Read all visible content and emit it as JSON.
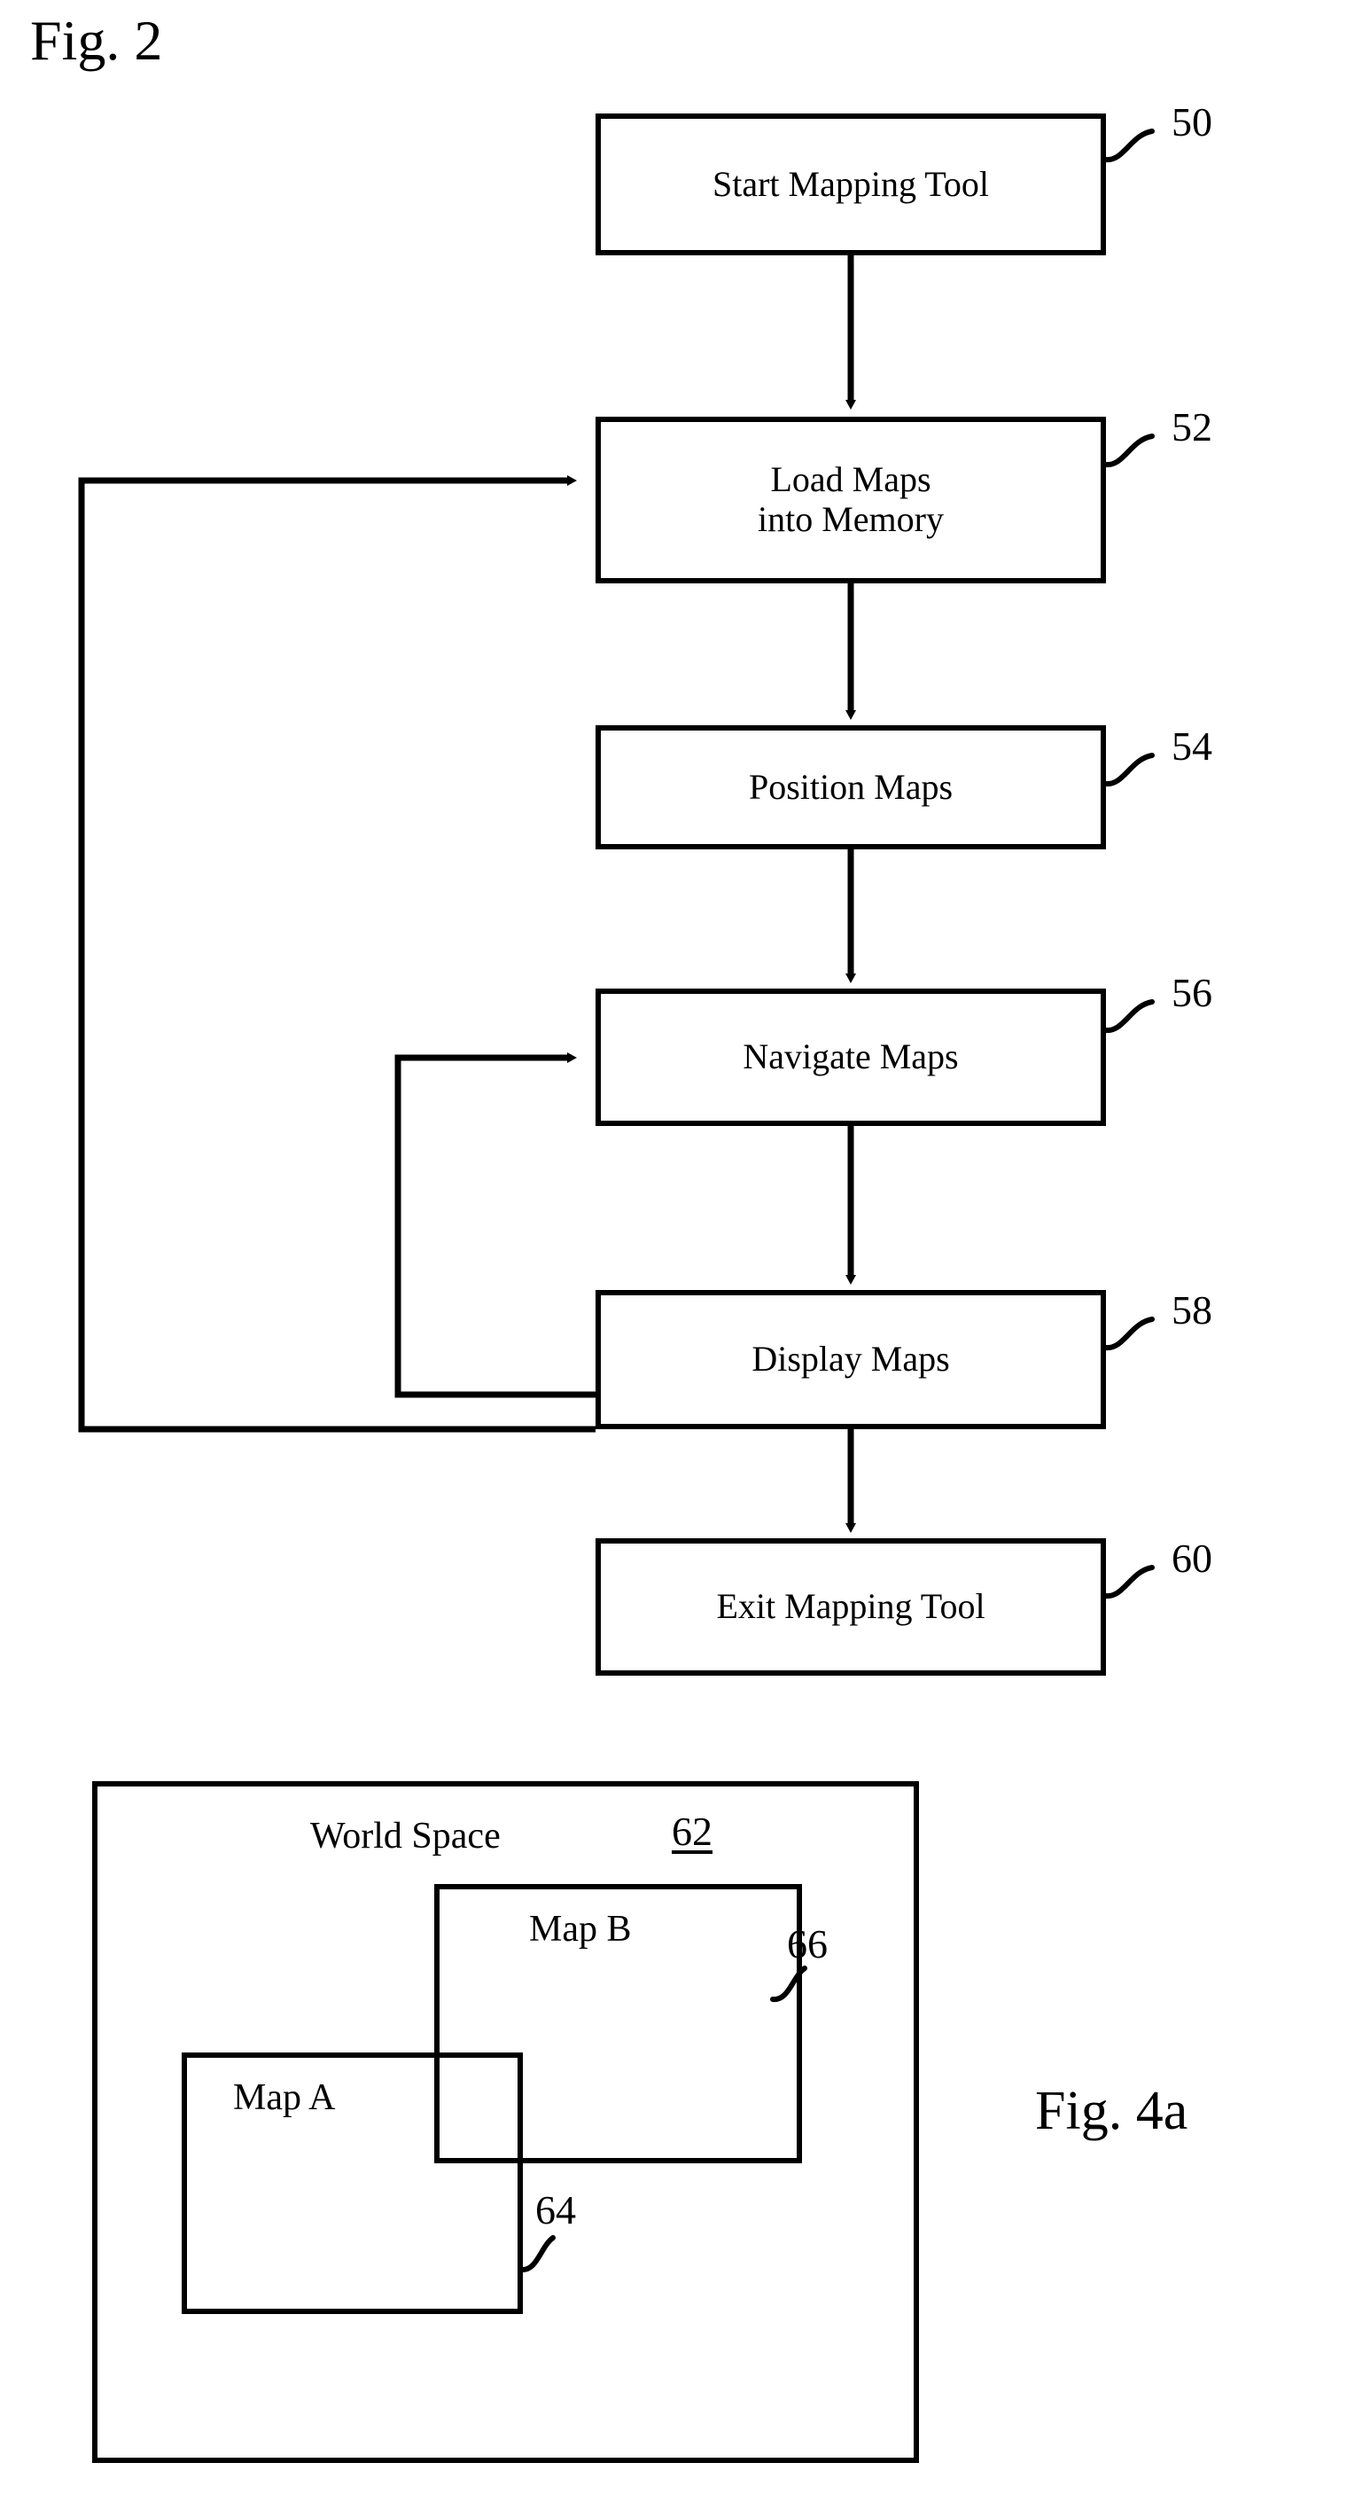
{
  "figures": {
    "fig2": {
      "caption": "Fig. 2"
    },
    "fig4a": {
      "caption": "Fig. 4a"
    }
  },
  "flowchart": {
    "title": "Fig. 2",
    "nodes": [
      {
        "id": "start",
        "label": "Start Mapping Tool",
        "ref": "50"
      },
      {
        "id": "load",
        "label": "Load Maps\ninto Memory",
        "ref": "52"
      },
      {
        "id": "position",
        "label": "Position Maps",
        "ref": "54"
      },
      {
        "id": "navigate",
        "label": "Navigate Maps",
        "ref": "56"
      },
      {
        "id": "display",
        "label": "Display Maps",
        "ref": "58"
      },
      {
        "id": "exit",
        "label": "Exit Mapping Tool",
        "ref": "60"
      }
    ],
    "edges": [
      {
        "from": "start",
        "to": "load",
        "kind": "arrow-down"
      },
      {
        "from": "load",
        "to": "position",
        "kind": "arrow-down"
      },
      {
        "from": "position",
        "to": "navigate",
        "kind": "arrow-down"
      },
      {
        "from": "navigate",
        "to": "display",
        "kind": "arrow-down"
      },
      {
        "from": "display",
        "to": "exit",
        "kind": "arrow-down"
      },
      {
        "from": "display",
        "to": "navigate",
        "kind": "feedback-inner"
      },
      {
        "from": "display",
        "to": "load",
        "kind": "feedback-outer"
      }
    ]
  },
  "world_space": {
    "title": "World Space",
    "ref": "62",
    "maps": [
      {
        "label": "Map A",
        "ref": "64"
      },
      {
        "label": "Map B",
        "ref": "66"
      }
    ]
  },
  "style": {
    "stroke": "#000000",
    "background": "#ffffff"
  }
}
